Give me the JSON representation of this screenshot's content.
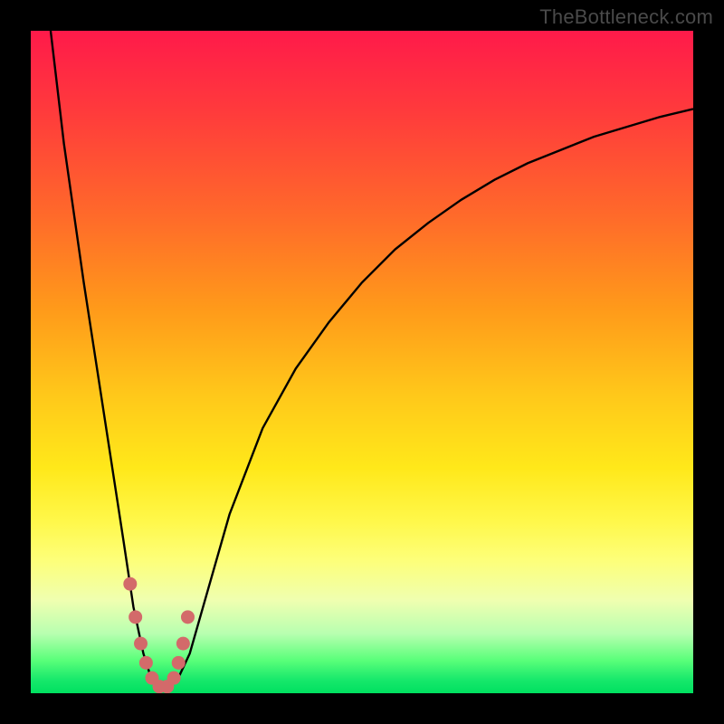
{
  "attribution": "TheBottleneck.com",
  "chart_data": {
    "type": "line",
    "title": "",
    "xlabel": "",
    "ylabel": "",
    "xlim": [
      0,
      100
    ],
    "ylim": [
      0,
      100
    ],
    "series": [
      {
        "name": "bottleneck-curve",
        "x": [
          3,
          5,
          8,
          10,
          12,
          14,
          15.5,
          17,
          18,
          19,
          20,
          21,
          22.5,
          24,
          26,
          30,
          35,
          40,
          45,
          50,
          55,
          60,
          65,
          70,
          75,
          80,
          85,
          90,
          95,
          100
        ],
        "values": [
          100,
          83,
          62,
          49,
          36,
          23,
          13,
          6,
          2.8,
          1.3,
          1.0,
          1.3,
          2.8,
          6,
          13,
          27,
          40,
          49,
          56,
          62,
          67,
          71,
          74.5,
          77.5,
          80,
          82,
          84,
          85.5,
          87,
          88.2
        ]
      }
    ],
    "markers": {
      "name": "highlight-dots",
      "color": "#d36a6a",
      "x": [
        15.0,
        15.8,
        16.6,
        17.4,
        18.3,
        19.4,
        20.6,
        21.6,
        22.3,
        23.0,
        23.7
      ],
      "values": [
        16.5,
        11.5,
        7.5,
        4.6,
        2.3,
        1.0,
        1.0,
        2.3,
        4.6,
        7.5,
        11.5
      ]
    }
  }
}
